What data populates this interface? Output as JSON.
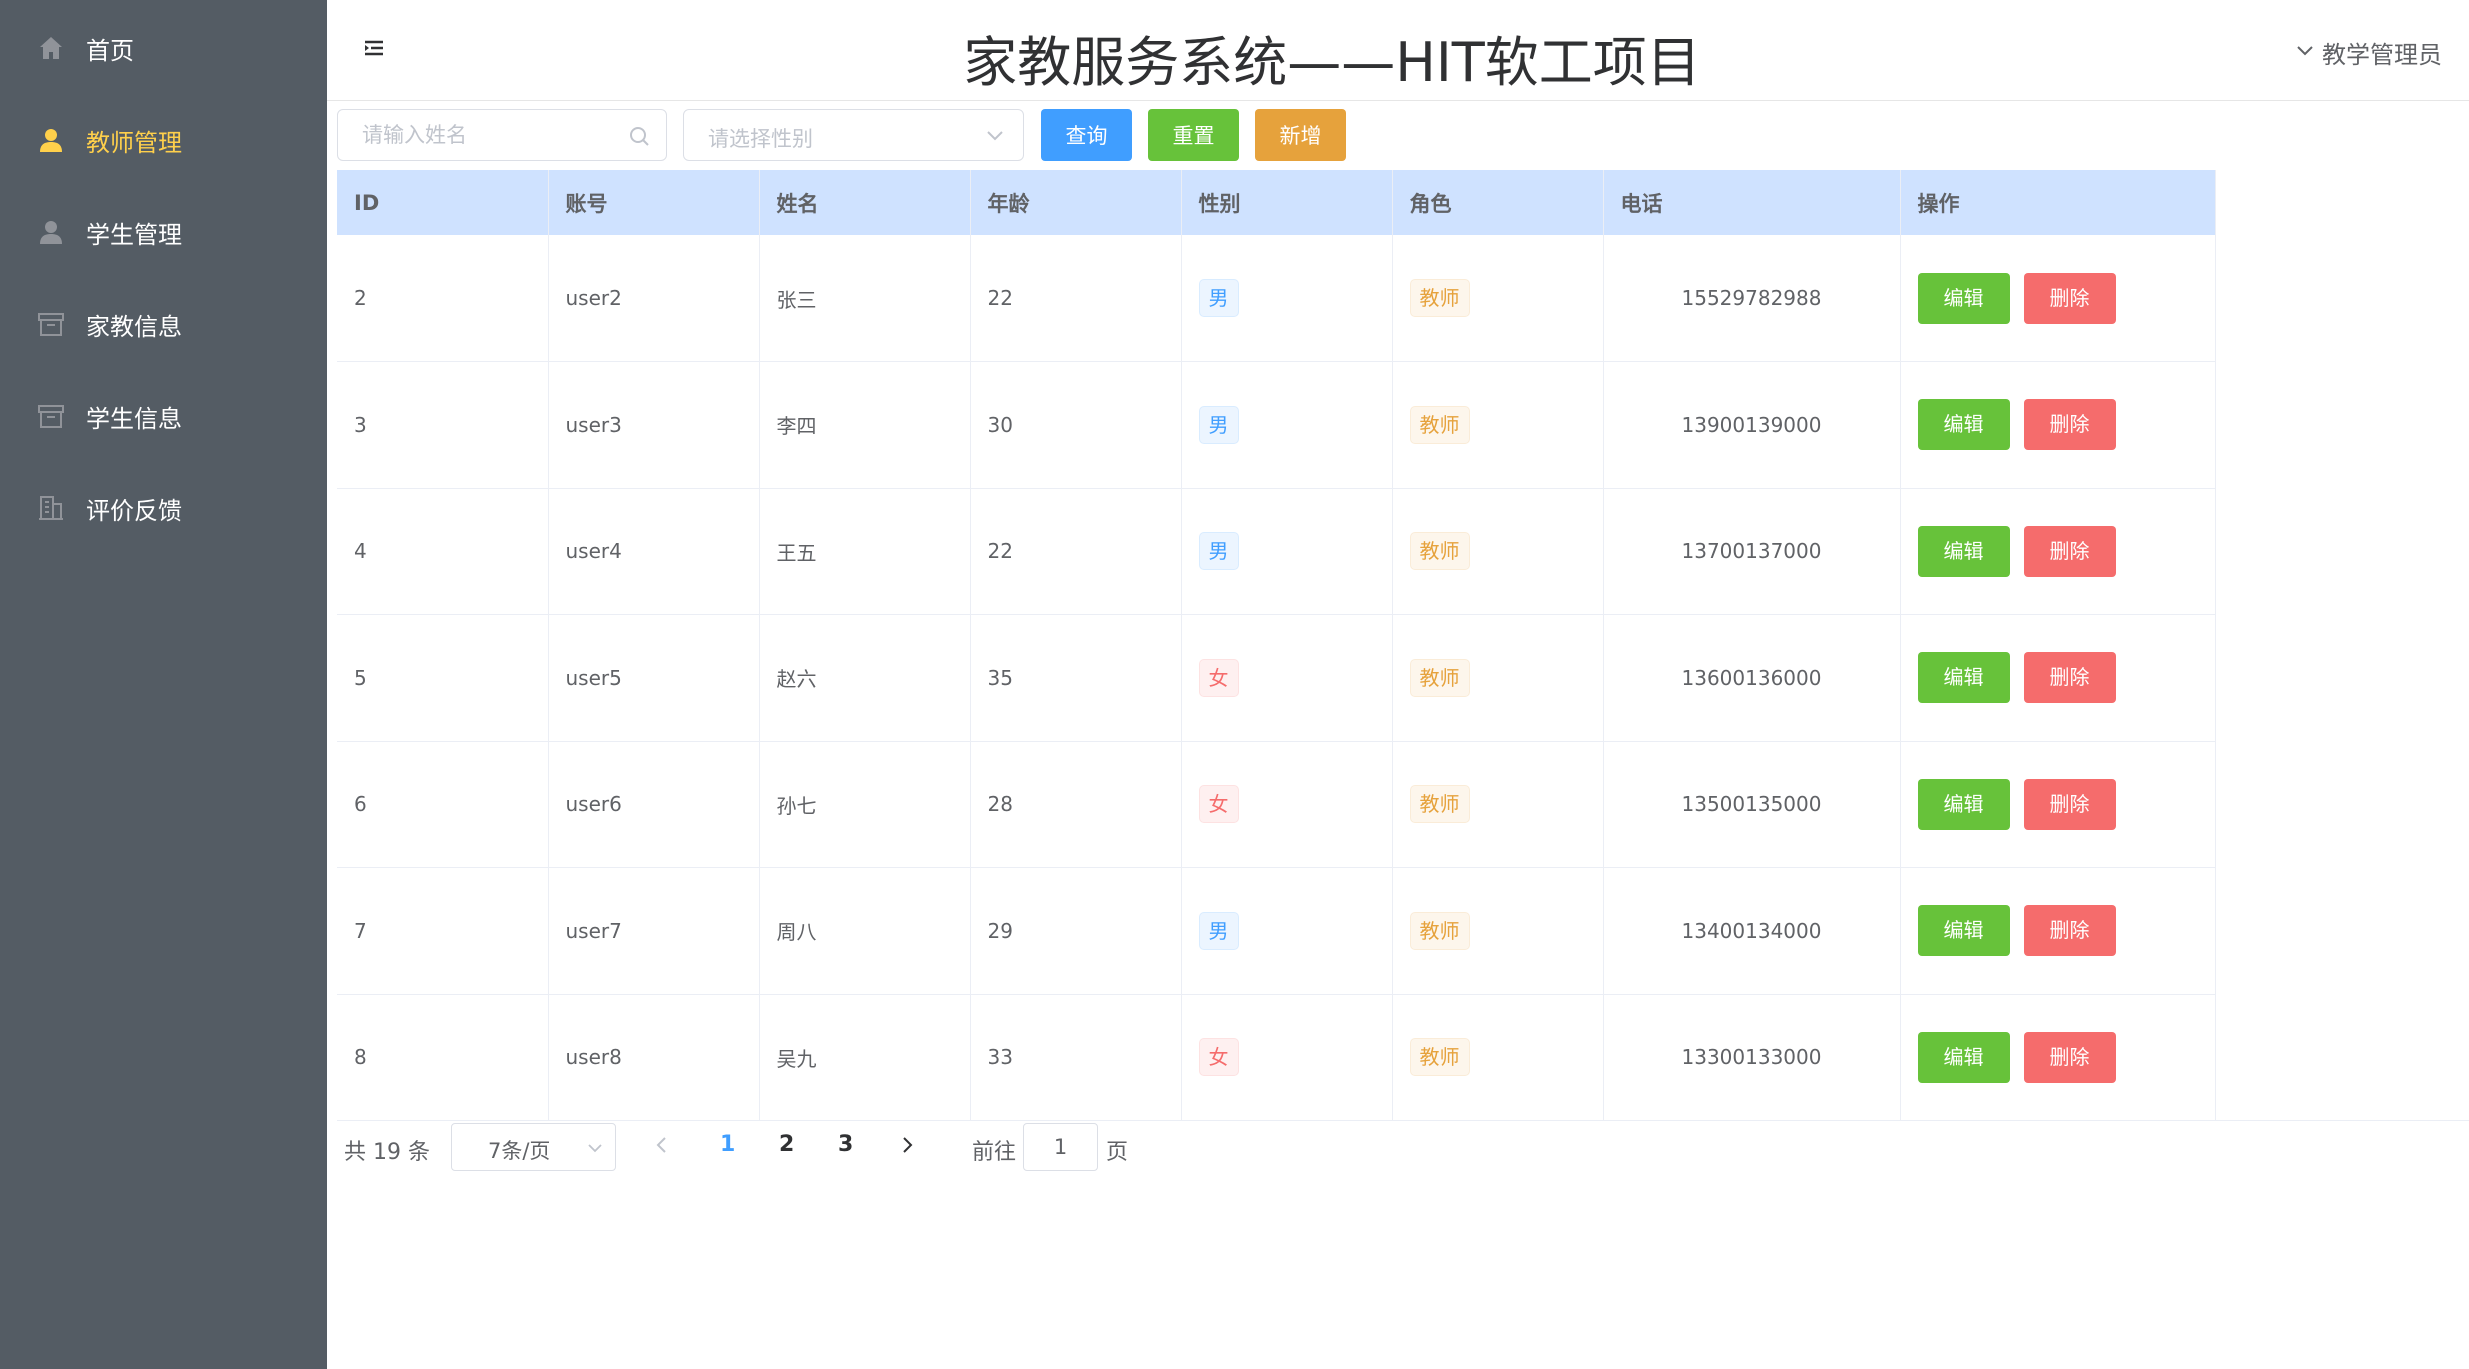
{
  "sidebar": {
    "items": [
      {
        "label": "首页",
        "icon": "home-icon",
        "active": false
      },
      {
        "label": "教师管理",
        "icon": "user-icon",
        "active": true
      },
      {
        "label": "学生管理",
        "icon": "user-icon",
        "active": false
      },
      {
        "label": "家教信息",
        "icon": "box-icon",
        "active": false
      },
      {
        "label": "学生信息",
        "icon": "box-icon",
        "active": false
      },
      {
        "label": "评价反馈",
        "icon": "building-icon",
        "active": false
      }
    ]
  },
  "header": {
    "title": "家教服务系统——HIT软工项目",
    "user": "教学管理员"
  },
  "toolbar": {
    "search_placeholder": "请输入姓名",
    "gender_placeholder": "请选择性别",
    "query_label": "查询",
    "reset_label": "重置",
    "add_label": "新增"
  },
  "table": {
    "columns": [
      "ID",
      "账号",
      "姓名",
      "年龄",
      "性别",
      "角色",
      "电话",
      "操作"
    ],
    "edit_label": "编辑",
    "delete_label": "删除",
    "rows": [
      {
        "id": "2",
        "account": "user2",
        "name": "张三",
        "age": "22",
        "gender": "男",
        "role": "教师",
        "phone": "15529782988"
      },
      {
        "id": "3",
        "account": "user3",
        "name": "李四",
        "age": "30",
        "gender": "男",
        "role": "教师",
        "phone": "13900139000"
      },
      {
        "id": "4",
        "account": "user4",
        "name": "王五",
        "age": "22",
        "gender": "男",
        "role": "教师",
        "phone": "13700137000"
      },
      {
        "id": "5",
        "account": "user5",
        "name": "赵六",
        "age": "35",
        "gender": "女",
        "role": "教师",
        "phone": "13600136000"
      },
      {
        "id": "6",
        "account": "user6",
        "name": "孙七",
        "age": "28",
        "gender": "女",
        "role": "教师",
        "phone": "13500135000"
      },
      {
        "id": "7",
        "account": "user7",
        "name": "周八",
        "age": "29",
        "gender": "男",
        "role": "教师",
        "phone": "13400134000"
      },
      {
        "id": "8",
        "account": "user8",
        "name": "吴九",
        "age": "33",
        "gender": "女",
        "role": "教师",
        "phone": "13300133000"
      }
    ]
  },
  "pagination": {
    "total_text": "共 19 条",
    "page_size": "7条/页",
    "pages": [
      "1",
      "2",
      "3"
    ],
    "current_page": "1",
    "goto_prefix": "前往",
    "goto_value": "1",
    "goto_suffix": "页"
  },
  "colors": {
    "sidebar_bg": "#545c64",
    "active_menu": "#ffd04b",
    "primary": "#409eff",
    "success": "#67c23a",
    "warning": "#e6a23c",
    "danger": "#f56c6c",
    "table_header_bg": "#cfe2ff"
  }
}
